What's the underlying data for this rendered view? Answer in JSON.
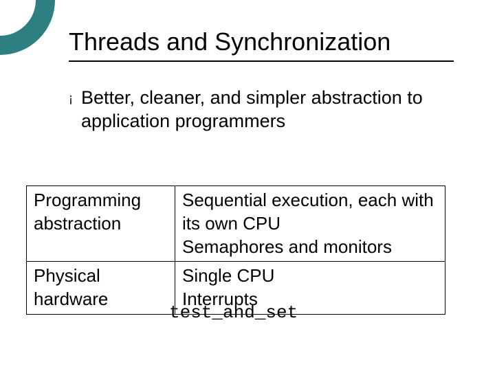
{
  "title": "Threads and Synchronization",
  "bullet": {
    "marker": "¡",
    "text": "Better, cleaner, and simpler abstraction to application programmers"
  },
  "table": {
    "rows": [
      {
        "left": "Programming abstraction",
        "right_line1": "Sequential execution, each with its own CPU",
        "right_line2": "Semaphores and monitors"
      },
      {
        "left": "Physical hardware",
        "right_line1": "Single CPU",
        "right_line2": "Interrupts"
      }
    ],
    "overflow": "test_and_set"
  }
}
